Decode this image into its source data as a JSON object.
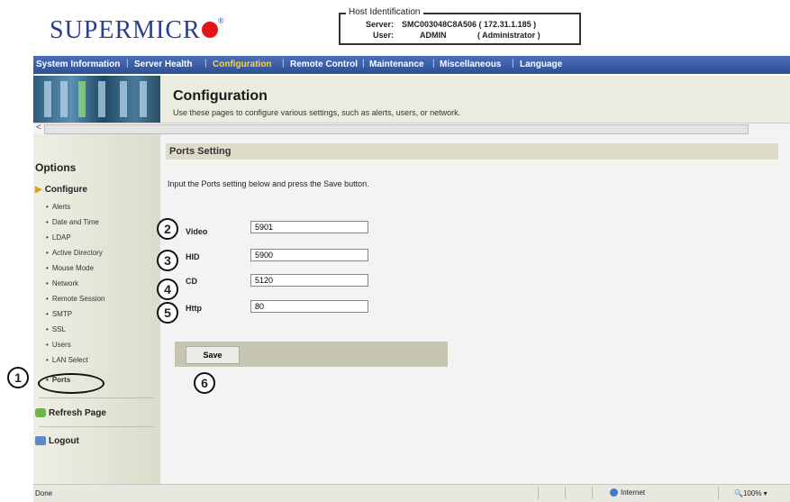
{
  "brand": {
    "logo_text": "SUPERMICR",
    "registered": "®"
  },
  "host": {
    "legend": "Host Identification",
    "server_label": "Server:",
    "server_value": "SMC003048C8A506 ( 172.31.1.185 )",
    "user_label": "User:",
    "user_value": "ADMIN",
    "user_role": "( Administrator )"
  },
  "nav": [
    {
      "label": "System Information"
    },
    {
      "label": "Server Health"
    },
    {
      "label": "Configuration"
    },
    {
      "label": "Remote Control"
    },
    {
      "label": "Maintenance"
    },
    {
      "label": "Miscellaneous"
    },
    {
      "label": "Language"
    }
  ],
  "nav_separator": "|",
  "banner": {
    "title": "Configuration",
    "description": "Use these pages to configure various settings, such as alerts, users, or network."
  },
  "scroll_arrow": "<",
  "sidebar": {
    "title": "Options",
    "configure_label": "Configure",
    "items": [
      "Alerts",
      "Date and Time",
      "LDAP",
      "Active Directory",
      "Mouse Mode",
      "Network",
      "Remote Session",
      "SMTP",
      "SSL",
      "Users",
      "LAN Select",
      "Ports"
    ],
    "refresh_label": "Refresh Page",
    "logout_label": "Logout"
  },
  "main": {
    "section_title": "Ports Setting",
    "instruction": "Input the Ports setting below and press the Save button.",
    "fields": [
      {
        "label": "Video",
        "value": "5901"
      },
      {
        "label": "HID",
        "value": "5900"
      },
      {
        "label": "CD",
        "value": "5120"
      },
      {
        "label": "Http",
        "value": "80"
      }
    ],
    "save_label": "Save"
  },
  "callouts": [
    "1",
    "2",
    "3",
    "4",
    "5",
    "6"
  ],
  "status": {
    "left": "Done",
    "zone": "Internet",
    "zoom": "100%"
  }
}
